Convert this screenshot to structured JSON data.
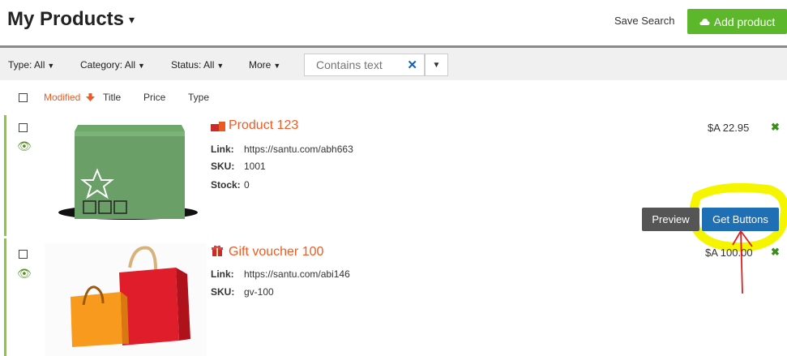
{
  "header": {
    "title": "My Products",
    "save_search": "Save Search",
    "add_product": "Add product"
  },
  "filters": {
    "type": "Type: All",
    "category": "Category: All",
    "status": "Status: All",
    "more": "More",
    "search_placeholder": "Contains text"
  },
  "columns": {
    "modified": "Modified",
    "title": "Title",
    "price": "Price",
    "type": "Type"
  },
  "products": [
    {
      "title": "Product 123",
      "link_label": "Link:",
      "link": "https://santu.com/abh663",
      "sku_label": "SKU:",
      "sku": "1001",
      "stock_label": "Stock:",
      "stock": "0",
      "price": "$A 22.95"
    },
    {
      "title": "Gift voucher 100",
      "link_label": "Link:",
      "link": "https://santu.com/abi146",
      "sku_label": "SKU:",
      "sku": "gv-100",
      "price": "$A 100.00"
    }
  ],
  "actions": {
    "preview": "Preview",
    "get_buttons": "Get Buttons"
  },
  "colors": {
    "accent_orange": "#f15a22",
    "add_green": "#5cb82a",
    "primary_blue": "#1f6fb5",
    "highlight_yellow": "#f5f500",
    "arrow_red": "#e02020"
  }
}
